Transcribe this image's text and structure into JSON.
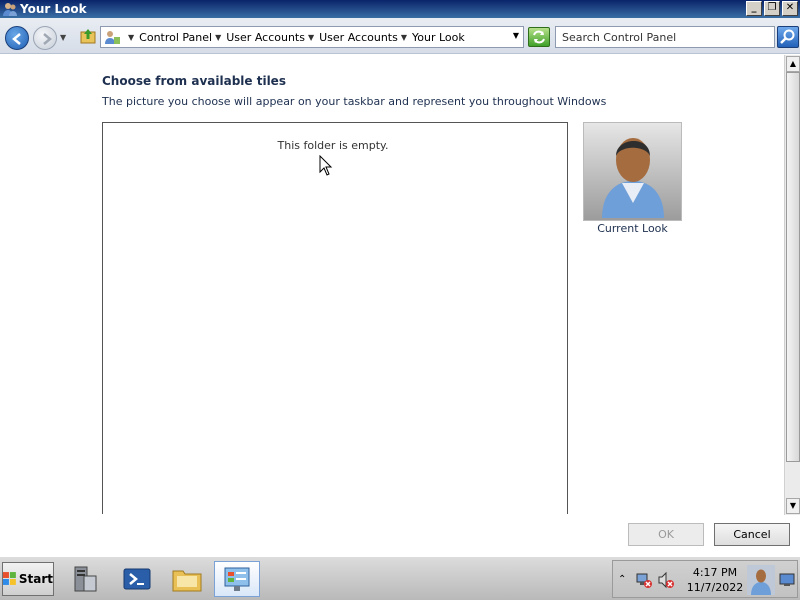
{
  "window": {
    "title": "Your Look",
    "controls": [
      "minimize",
      "restore",
      "close"
    ]
  },
  "address": {
    "breadcrumb": [
      "Control Panel",
      "User Accounts",
      "User Accounts",
      "Your Look"
    ],
    "search_placeholder": "Search Control Panel"
  },
  "main": {
    "heading": "Choose from available tiles",
    "description": "The picture you choose will appear on your taskbar and represent you throughout Windows",
    "empty_message": "This folder is empty.",
    "current_label": "Current Look",
    "ok_label": "OK",
    "cancel_label": "Cancel"
  },
  "taskbar": {
    "start_label": "Start",
    "apps": [
      "server-manager-icon",
      "powershell-icon",
      "folder-icon",
      "control-panel-icon"
    ],
    "time": "4:17 PM",
    "date": "11/7/2022"
  },
  "colors": {
    "heading": "#1e3050",
    "titlebar": "#0a246a"
  }
}
